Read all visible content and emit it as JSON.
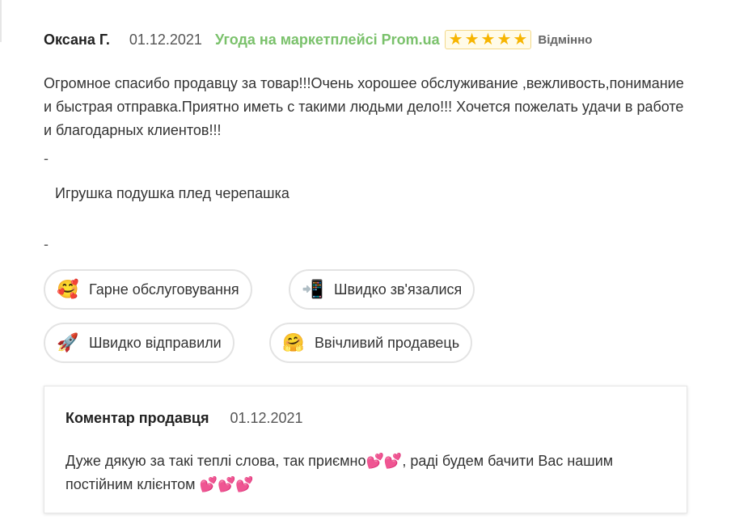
{
  "review": {
    "author": "Оксана Г.",
    "date": "01.12.2021",
    "deal": "Угода на маркетплейсі Prom.ua",
    "rating": 5,
    "rating_label": "Відмінно",
    "star_color": "#f7b500",
    "deal_color": "#7ac16b",
    "text": "Огромное спасибо продавцу за товар!!!Очень хорошее обслуживание ,вежливость,понимание и быстрая отправка.Приятно иметь с такими людьми дело!!! Хочется пожелать удачи в работе и благодарных клиентов!!!",
    "separator_top": "-",
    "product": "Игрушка подушка плед черепашка",
    "separator_bottom": "-"
  },
  "tags": [
    {
      "icon": "smiling-face-with-hearts-icon",
      "glyph": "🥰",
      "label": "Гарне обслуговування"
    },
    {
      "icon": "mobile-phone-arrow-icon",
      "glyph": "📲",
      "label": "Швидко зв'язалися"
    },
    {
      "icon": "rocket-icon",
      "glyph": "🚀",
      "label": "Швидко відправили"
    },
    {
      "icon": "hugging-face-icon",
      "glyph": "🤗",
      "label": "Ввічливий продавець"
    }
  ],
  "seller_comment": {
    "title": "Коментар продавця",
    "date": "01.12.2021",
    "text_part1": "Дуже дякую за такі теплі слова, так приємно",
    "hearts_1": "💕💕",
    "text_part2": ", раді будем бачити Вас нашим постійним клієнтом ",
    "hearts_2": "💕💕💕",
    "hearts_icon": "two-hearts-icon"
  }
}
